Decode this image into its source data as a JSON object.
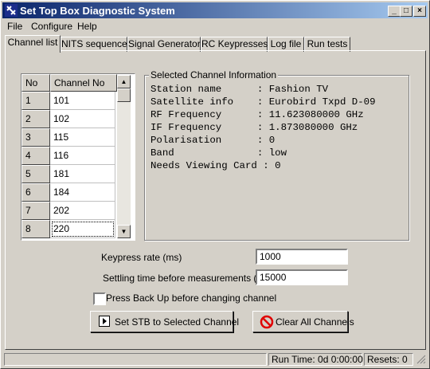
{
  "window": {
    "title": "Set Top Box Diagnostic System",
    "min_glyph": "_",
    "max_glyph": "□",
    "close_glyph": "×"
  },
  "menu": [
    {
      "label": "File"
    },
    {
      "label": "Configure"
    },
    {
      "label": "Help"
    }
  ],
  "tabs": [
    {
      "label": "Channel list"
    },
    {
      "label": "NITS sequence"
    },
    {
      "label": "Signal Generator"
    },
    {
      "label": "RC Keypresses"
    },
    {
      "label": "Log file"
    },
    {
      "label": "Run tests"
    }
  ],
  "grid": {
    "col_no": "No",
    "col_channel": "Channel No",
    "rows": [
      {
        "no": "1",
        "channel": "101"
      },
      {
        "no": "2",
        "channel": "102"
      },
      {
        "no": "3",
        "channel": "115"
      },
      {
        "no": "4",
        "channel": "116"
      },
      {
        "no": "5",
        "channel": "181"
      },
      {
        "no": "6",
        "channel": "184"
      },
      {
        "no": "7",
        "channel": "202"
      },
      {
        "no": "8",
        "channel": "220"
      }
    ],
    "scroll_up": "▲",
    "scroll_down": "▼"
  },
  "channel_info": {
    "group_label": "Selected Channel Information",
    "lines": [
      "Station name      : Fashion TV",
      "Satellite info    : Eurobird Txpd D-09",
      "RF Frequency      : 11.623080000 GHz",
      "IF Frequency      : 1.873080000 GHz",
      "Polarisation      : 0",
      "Band              : low",
      "Needs Viewing Card : 0"
    ]
  },
  "settings": {
    "keypress_label": "Keypress rate (ms)",
    "keypress_value": "1000",
    "settling_label": "Settling time before measurements (ms)",
    "settling_value": "15000",
    "backup_label": "Press Back Up before changing channel"
  },
  "buttons": {
    "set_stb": "Set STB to Selected Channel",
    "clear_all": "Clear All Channels"
  },
  "status": {
    "run_time": "Run Time: 0d 0:00:00",
    "resets": "Resets: 0"
  },
  "colors": {
    "titlebar_start": "#0a246a",
    "titlebar_end": "#a6caf0",
    "clear_icon": "#e00000"
  }
}
